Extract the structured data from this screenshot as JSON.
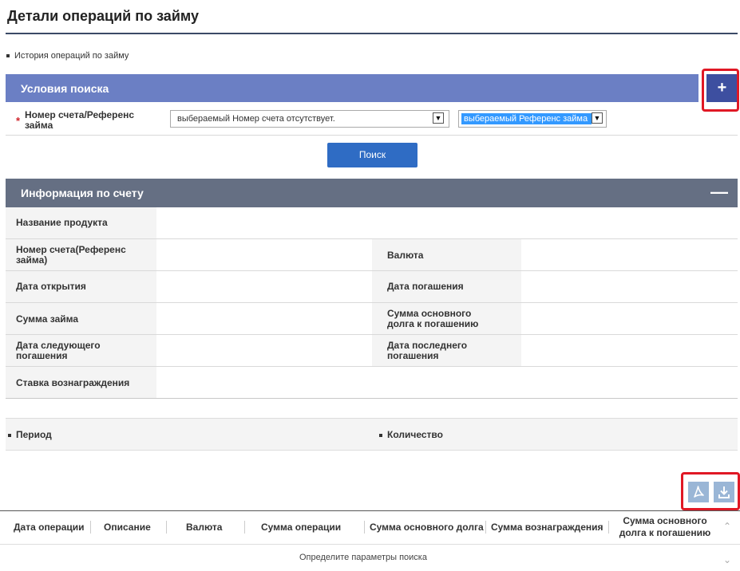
{
  "page": {
    "title": "Детали операций по займу",
    "history_link": "История операций по займу"
  },
  "search": {
    "header": "Условия поиска",
    "expand_icon": "plus-icon",
    "required_mark": "*",
    "account_label": "Номер счета/Референс займа",
    "account_select_value": "выбераемый Номер счета отсутствует.",
    "reference_select_value": "выберaемый Референс займа",
    "search_button": "Поиск"
  },
  "account_info": {
    "header": "Информация по счету",
    "collapse_icon": "minus-icon",
    "product_name": "Название продукта",
    "account_number": "Номер счета(Референс займа)",
    "currency": "Валюта",
    "open_date": "Дата открытия",
    "repayment_date": "Дата погашения",
    "loan_amount": "Сумма займа",
    "principal_due": "Сумма основного долга к погашению",
    "next_repayment": "Дата следующего погашения",
    "last_repayment": "Дата последнего погашения",
    "interest_rate": "Ставка вознаграждения"
  },
  "filters": {
    "period": "Период",
    "quantity": "Количество"
  },
  "actions": {
    "pdf_icon": "pdf-icon",
    "download_icon": "download-icon"
  },
  "table": {
    "headers": [
      "Дата операции",
      "Описание",
      "Валюта",
      "Сумма операции",
      "Сумма основного долга",
      "Сумма вознаграждения",
      "Сумма основного долга к погашению"
    ],
    "empty_message": "Определите параметры поиска"
  },
  "colors": {
    "search_bar": "#6b7fc4",
    "info_bar": "#656f83",
    "button": "#2f6cc4",
    "highlight": "#e01825"
  }
}
